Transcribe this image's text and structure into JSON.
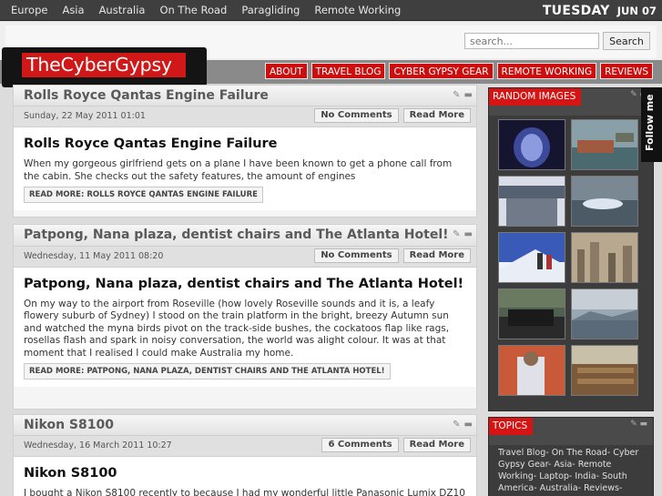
{
  "topbar": {
    "nav": [
      "Europe",
      "Asia",
      "Australia",
      "On The Road",
      "Paragliding",
      "Remote Working"
    ],
    "day": "TUESDAY",
    "date": "JUN 07"
  },
  "header": {
    "search_placeholder": "search...",
    "search_button": "Search",
    "logo": "TheCyberGypsy",
    "main_nav": [
      "ABOUT",
      "TRAVEL BLOG",
      "CYBER GYPSY GEAR",
      "REMOTE WORKING",
      "REVIEWS"
    ]
  },
  "posts": [
    {
      "title": "Rolls Royce Qantas Engine Failure",
      "date": "Sunday, 22 May 2011 01:01",
      "comments": "No Comments",
      "read_more_btn": "Read More",
      "heading": "Rolls Royce Qantas Engine Failure",
      "excerpt": "When my gorgeous girlfriend gets on a plane I have been known to get a phone call from the cabin. She checks out the safety features, the amount of engines",
      "read_more": "READ MORE: ROLLS ROYCE QANTAS ENGINE FAILURE"
    },
    {
      "title": "Patpong, Nana plaza, dentist chairs and The Atlanta Hotel!",
      "date": "Wednesday, 11 May 2011 08:20",
      "comments": "No Comments",
      "read_more_btn": "Read More",
      "heading": "Patpong, Nana plaza, dentist chairs and The Atlanta Hotel!",
      "excerpt": "On my way to the airport from Roseville (how lovely Roseville sounds and it is, a leafy flowery suburb of Sydney) I stood on the train platform in the bright, breezy Autumn sun and watched the myna birds pivot on the track-side bushes, the cockatoos flap like rags, rosellas flash and spark in noisy conversation, the world was alight colour. It was at that moment that I realised I could make Australia my home.",
      "read_more": "READ MORE: PATPONG, NANA PLAZA, DENTIST CHAIRS AND THE ATLANTA HOTEL!"
    },
    {
      "title": "Nikon S8100",
      "date": "Wednesday, 16 March 2011 10:27",
      "comments": "6 Comments",
      "read_more_btn": "Read More",
      "heading": "Nikon S8100",
      "excerpt": "I bought a Nikon S8100 recently to because I had my wonderful little Panasonic Lumix DZ10"
    }
  ],
  "sidebar": {
    "random_images_title": "RANDOM IMAGES",
    "topics_title": "TOPICS",
    "topics_text": "Travel Blog- On The Road- Cyber Gypsy Gear- Asia- Remote Working- Laptop- India- South America- Australia- Reviews-",
    "follow_me": "Follow me"
  },
  "colors": {
    "accent_red": "#cc0e0e",
    "topbar_bg": "#3f3f3f",
    "sidebar_bg": "#3c3c3c"
  }
}
